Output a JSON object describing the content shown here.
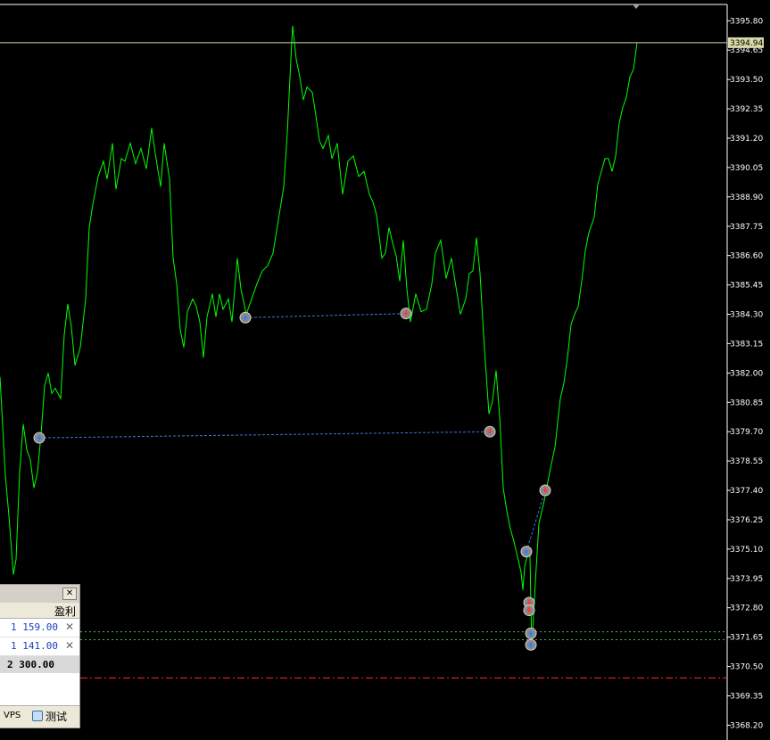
{
  "chart_data": {
    "type": "line",
    "background": "#000000",
    "line_color": "#00ff00",
    "ylim": [
      3367.62,
      3396.44
    ],
    "y_ticks": [
      3395.8,
      3394.65,
      3393.5,
      3392.35,
      3391.2,
      3390.05,
      3388.9,
      3387.75,
      3386.6,
      3385.45,
      3384.3,
      3383.15,
      3382.0,
      3380.85,
      3379.7,
      3378.55,
      3377.4,
      3376.25,
      3375.1,
      3373.95,
      3372.8,
      3371.65,
      3370.5,
      3369.35,
      3368.2
    ],
    "y_tick_labels": [
      "3395.80",
      "3394.65",
      "3393.50",
      "3392.35",
      "3391.20",
      "3390.05",
      "3388.90",
      "3387.75",
      "3386.60",
      "3385.45",
      "3384.30",
      "3383.15",
      "3382.00",
      "3380.85",
      "3379.70",
      "3378.55",
      "3377.40",
      "3376.25",
      "3375.10",
      "3373.95",
      "3372.80",
      "3371.65",
      "3370.50",
      "3369.35",
      "3368.20"
    ],
    "current_price": 3394.94,
    "current_price_label": "3394.94",
    "bar_count": 714,
    "series": [
      {
        "values": [
          [
            0,
            3381.85
          ],
          [
            6,
            3378.0
          ],
          [
            10,
            3376.4
          ],
          [
            15,
            3374.1
          ],
          [
            18,
            3374.7
          ],
          [
            22,
            3378.1
          ],
          [
            26,
            3380.0
          ],
          [
            30,
            3379.0
          ],
          [
            34,
            3378.6
          ],
          [
            38,
            3377.5
          ],
          [
            42,
            3378.1
          ],
          [
            46,
            3379.6
          ],
          [
            50,
            3381.5
          ],
          [
            54,
            3382.0
          ],
          [
            58,
            3381.2
          ],
          [
            62,
            3381.4
          ],
          [
            68,
            3381.0
          ],
          [
            72,
            3383.5
          ],
          [
            76,
            3384.7
          ],
          [
            80,
            3383.8
          ],
          [
            84,
            3382.3
          ],
          [
            90,
            3383.0
          ],
          [
            96,
            3384.9
          ],
          [
            100,
            3387.7
          ],
          [
            104,
            3388.6
          ],
          [
            110,
            3389.7
          ],
          [
            116,
            3390.3
          ],
          [
            120,
            3389.6
          ],
          [
            126,
            3391.0
          ],
          [
            130,
            3389.2
          ],
          [
            136,
            3390.4
          ],
          [
            140,
            3390.3
          ],
          [
            146,
            3391.0
          ],
          [
            152,
            3390.2
          ],
          [
            158,
            3390.8
          ],
          [
            164,
            3390.0
          ],
          [
            170,
            3391.6
          ],
          [
            174,
            3390.6
          ],
          [
            180,
            3389.3
          ],
          [
            184,
            3391.0
          ],
          [
            190,
            3389.6
          ],
          [
            194,
            3386.5
          ],
          [
            198,
            3385.5
          ],
          [
            202,
            3383.7
          ],
          [
            206,
            3383.0
          ],
          [
            210,
            3384.4
          ],
          [
            216,
            3384.9
          ],
          [
            220,
            3384.6
          ],
          [
            224,
            3384.0
          ],
          [
            228,
            3382.6
          ],
          [
            232,
            3384.2
          ],
          [
            238,
            3385.1
          ],
          [
            242,
            3384.2
          ],
          [
            246,
            3385.1
          ],
          [
            250,
            3384.5
          ],
          [
            256,
            3384.9
          ],
          [
            260,
            3384.0
          ],
          [
            266,
            3386.5
          ],
          [
            270,
            3385.3
          ],
          [
            276,
            3384.3
          ],
          [
            282,
            3384.9
          ],
          [
            288,
            3385.5
          ],
          [
            294,
            3386.0
          ],
          [
            300,
            3386.2
          ],
          [
            306,
            3386.7
          ],
          [
            312,
            3388.0
          ],
          [
            318,
            3389.3
          ],
          [
            322,
            3391.4
          ],
          [
            326,
            3394.3
          ],
          [
            328,
            3395.6
          ],
          [
            332,
            3394.3
          ],
          [
            336,
            3393.6
          ],
          [
            340,
            3392.7
          ],
          [
            344,
            3393.2
          ],
          [
            350,
            3393.0
          ],
          [
            354,
            3392.1
          ],
          [
            358,
            3391.1
          ],
          [
            362,
            3390.8
          ],
          [
            368,
            3391.3
          ],
          [
            372,
            3390.4
          ],
          [
            378,
            3391.0
          ],
          [
            384,
            3389.0
          ],
          [
            390,
            3390.3
          ],
          [
            396,
            3390.5
          ],
          [
            402,
            3389.7
          ],
          [
            408,
            3389.9
          ],
          [
            414,
            3389.0
          ],
          [
            418,
            3388.7
          ],
          [
            422,
            3388.2
          ],
          [
            428,
            3386.5
          ],
          [
            432,
            3386.7
          ],
          [
            436,
            3387.7
          ],
          [
            440,
            3387.1
          ],
          [
            444,
            3386.6
          ],
          [
            448,
            3385.6
          ],
          [
            452,
            3387.2
          ],
          [
            456,
            3385.3
          ],
          [
            460,
            3384.0
          ],
          [
            466,
            3385.1
          ],
          [
            472,
            3384.4
          ],
          [
            478,
            3384.5
          ],
          [
            484,
            3385.5
          ],
          [
            488,
            3386.7
          ],
          [
            494,
            3387.2
          ],
          [
            500,
            3385.7
          ],
          [
            506,
            3386.5
          ],
          [
            510,
            3385.6
          ],
          [
            516,
            3384.3
          ],
          [
            522,
            3384.9
          ],
          [
            526,
            3385.9
          ],
          [
            530,
            3386.0
          ],
          [
            534,
            3387.3
          ],
          [
            538,
            3385.9
          ],
          [
            542,
            3383.5
          ],
          [
            546,
            3381.4
          ],
          [
            548,
            3380.4
          ],
          [
            552,
            3380.9
          ],
          [
            556,
            3382.1
          ],
          [
            560,
            3380.3
          ],
          [
            564,
            3377.5
          ],
          [
            568,
            3376.6
          ],
          [
            572,
            3375.9
          ],
          [
            576,
            3375.4
          ],
          [
            580,
            3374.8
          ],
          [
            584,
            3374.2
          ],
          [
            586,
            3373.5
          ],
          [
            588,
            3374.4
          ],
          [
            592,
            3375.0
          ],
          [
            594,
            3374.8
          ],
          [
            596,
            3371.2
          ],
          [
            598,
            3372.5
          ],
          [
            600,
            3373.8
          ],
          [
            604,
            3376.1
          ],
          [
            610,
            3377.0
          ],
          [
            616,
            3378.1
          ],
          [
            622,
            3379.1
          ],
          [
            628,
            3381.0
          ],
          [
            632,
            3381.6
          ],
          [
            636,
            3382.6
          ],
          [
            640,
            3383.9
          ],
          [
            644,
            3384.3
          ],
          [
            648,
            3384.6
          ],
          [
            652,
            3385.6
          ],
          [
            656,
            3386.8
          ],
          [
            660,
            3387.5
          ],
          [
            666,
            3388.1
          ],
          [
            670,
            3389.4
          ],
          [
            674,
            3389.9
          ],
          [
            678,
            3390.4
          ],
          [
            682,
            3390.4
          ],
          [
            686,
            3389.9
          ],
          [
            690,
            3390.5
          ],
          [
            694,
            3391.8
          ],
          [
            698,
            3392.4
          ],
          [
            702,
            3392.8
          ],
          [
            706,
            3393.6
          ],
          [
            710,
            3393.9
          ],
          [
            714,
            3394.94
          ]
        ]
      }
    ],
    "trades": [
      {
        "open": {
          "bar": 44,
          "price": 3379.46,
          "dir": "buy"
        },
        "close": {
          "bar": 549,
          "price": 3379.7,
          "dir": "sell"
        }
      },
      {
        "open": {
          "bar": 275,
          "price": 3384.17,
          "dir": "buy"
        },
        "close": {
          "bar": 455,
          "price": 3384.33,
          "dir": "sell"
        }
      },
      {
        "open": {
          "bar": 590,
          "price": 3375.0,
          "dir": "buy"
        },
        "close": {
          "bar": 611,
          "price": 3377.4,
          "dir": "sell"
        }
      }
    ],
    "extra_markers": [
      {
        "bar": 593,
        "price": 3373.0,
        "dir": "sell"
      },
      {
        "bar": 593,
        "price": 3372.7,
        "dir": "sell"
      },
      {
        "bar": 595,
        "price": 3371.8,
        "dir": "buy"
      },
      {
        "bar": 595,
        "price": 3371.35,
        "dir": "buy"
      }
    ],
    "level_lines": [
      {
        "price": 3371.86,
        "style": "dotted",
        "color": "#3fbf3f"
      },
      {
        "price": 3371.55,
        "style": "dotted",
        "color": "#3fbf3f"
      },
      {
        "price": 3370.05,
        "style": "dashdot",
        "color": "#ff2a2a"
      }
    ],
    "grid": false
  },
  "panel": {
    "close_label": "✕",
    "column_header": "盈利",
    "rows": [
      {
        "value": "1 159.00",
        "remove": "✕"
      },
      {
        "value": "1 141.00",
        "remove": "✕"
      }
    ],
    "total": "2 300.00",
    "footer_vps": "VPS",
    "footer_test": "测试"
  }
}
